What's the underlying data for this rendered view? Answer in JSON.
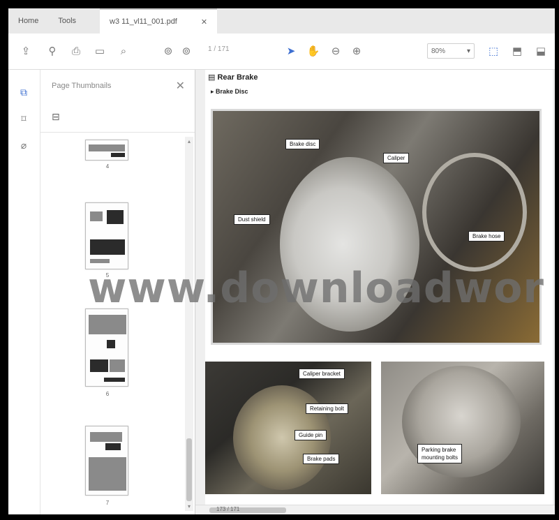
{
  "tabs": [
    {
      "label": "Home"
    },
    {
      "label": "Tools"
    },
    {
      "label": "w3 11_vl11_001.pdf"
    }
  ],
  "toolbar": {
    "page_field": "1 / 171",
    "zoom_value": "80%"
  },
  "thumbnails_panel": {
    "title": "Page Thumbnails",
    "pages": [
      "4",
      "5",
      "6",
      "7"
    ]
  },
  "document": {
    "section_title": "Rear Brake",
    "section_subtitle": "Brake Disc",
    "main_photo_labels": [
      "Brake disc",
      "Caliper",
      "Dust shield",
      "Brake hose"
    ],
    "bottom_left_labels": [
      "Caliper bracket",
      "Retaining bolt",
      "Guide pin",
      "Brake pads"
    ],
    "bottom_right_labels": [
      "Parking brake",
      "mounting bolts"
    ],
    "watermark": "www.downloadwor"
  },
  "status": {
    "page_indicator": "173 / 171"
  },
  "colors": {
    "accent": "#3d6fd1",
    "tabbar": "#e9e9e9",
    "frame": "#000000"
  }
}
